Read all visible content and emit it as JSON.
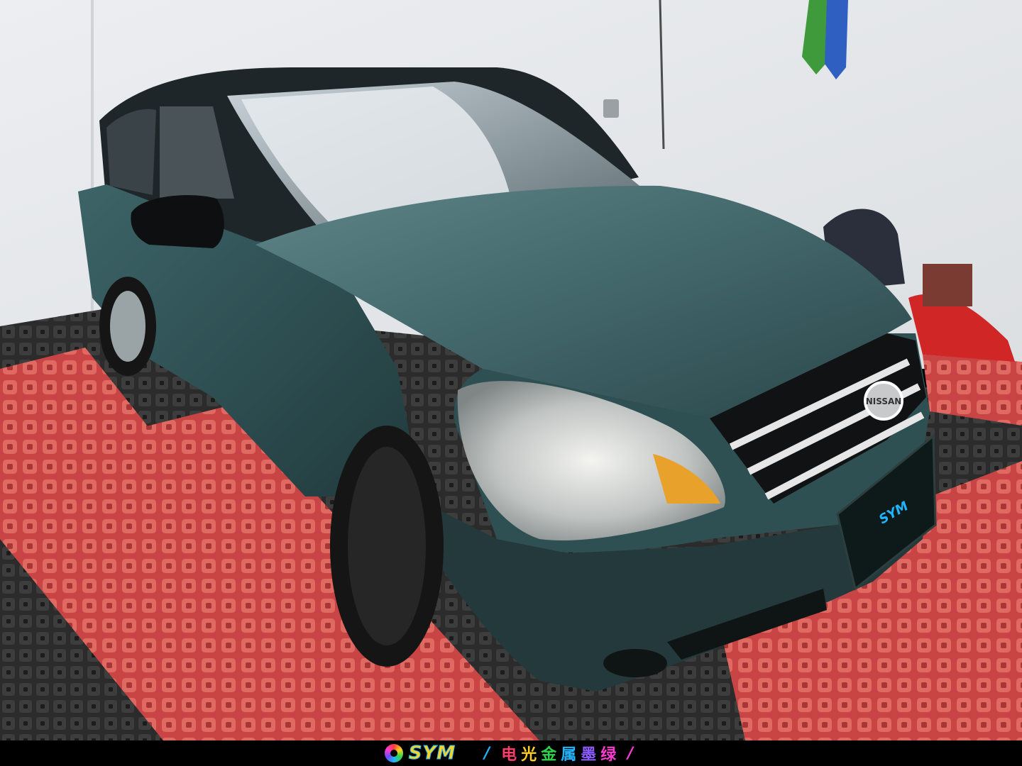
{
  "caption": {
    "brand": "SYM",
    "film_name": "电光金属墨绿",
    "separator": "/"
  },
  "plate": {
    "brand": "SYM"
  },
  "emblem": {
    "text": "NISSAN"
  },
  "colors": {
    "car_body": "#2e4f52",
    "floor_red": "#c94545",
    "floor_dark": "#2b2b2b",
    "wall": "#e9eaec"
  }
}
